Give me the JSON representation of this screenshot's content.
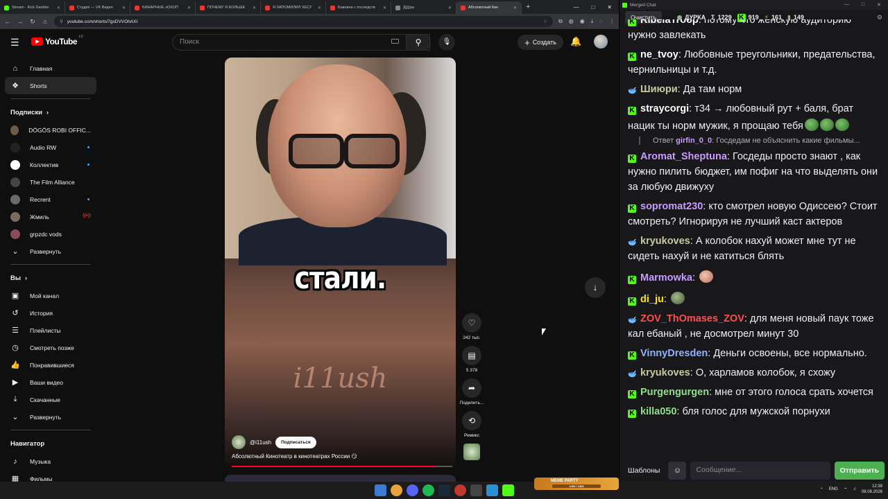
{
  "browser": {
    "tabs": [
      {
        "label": "Stream - Kick Dashbo",
        "color": "#53fc18"
      },
      {
        "label": "Студия — VK Видео",
        "color": "#e53935"
      },
      {
        "label": "БИНАРНЫЕ лОХОП",
        "color": "#e53935"
      },
      {
        "label": "ПОЧЕМУ Я БОЛЬШЕ",
        "color": "#e53935"
      },
      {
        "label": "Я ЗАПОМИЛИЛ ХЕСУ",
        "color": "#e53935"
      },
      {
        "label": "Бавовна с последств",
        "color": "#e53935"
      },
      {
        "label": "Дј)ј)ра",
        "color": "#888888"
      },
      {
        "label": "Абсолютный Кин",
        "color": "#e53935",
        "active": true
      }
    ],
    "url": "youtube.com/shorts/7gsDVVOhAXI"
  },
  "youtube": {
    "logo_text": "YouTube",
    "country_code": "LV",
    "search_placeholder": "Поиск",
    "create_label": "Создать",
    "nav": [
      {
        "icon": "home-icon",
        "glyph": "⌂",
        "label": "Главная"
      },
      {
        "icon": "shorts-icon",
        "glyph": "❖",
        "label": "Shorts",
        "active": true
      }
    ],
    "subscriptions_heading": "Подписки",
    "subscriptions": [
      {
        "label": "DÖGÖS ROBI OFFIC...",
        "color": "#6d5a48"
      },
      {
        "label": "Audio RW",
        "color": "#222222",
        "dot": true
      },
      {
        "label": "Коллектив",
        "color": "#ffffff",
        "dot": true
      },
      {
        "label": "The Film Alliance",
        "color": "#444444"
      },
      {
        "label": "Recrent",
        "color": "#6a6a6a",
        "dot": true
      },
      {
        "label": "Жмиль",
        "color": "#7a6a60",
        "live": true
      },
      {
        "label": "grpzdc vods",
        "color": "#8a4a5a"
      }
    ],
    "expand_label_1": "Развернуть",
    "you_heading": "Вы",
    "you_items": [
      {
        "icon": "channel-icon",
        "glyph": "▣",
        "label": "Мой канал"
      },
      {
        "icon": "history-icon",
        "glyph": "↺",
        "label": "История"
      },
      {
        "icon": "playlists-icon",
        "glyph": "☰",
        "label": "Плейлисты"
      },
      {
        "icon": "watch-later-icon",
        "glyph": "◷",
        "label": "Смотреть позже"
      },
      {
        "icon": "liked-icon",
        "glyph": "👍",
        "label": "Понравившиеся"
      },
      {
        "icon": "your-videos-icon",
        "glyph": "▶",
        "label": "Ваши видео"
      },
      {
        "icon": "downloads-icon",
        "glyph": "⤓",
        "label": "Скачанные"
      }
    ],
    "expand_label_2": "Развернуть",
    "navigator_heading": "Навигатор",
    "navigator_items": [
      {
        "icon": "music-icon",
        "glyph": "♪",
        "label": "Музыка"
      },
      {
        "icon": "movies-icon",
        "glyph": "▦",
        "label": "Фильмы"
      }
    ],
    "short": {
      "caption": "стали.",
      "watermark": "i11ush",
      "channel": "@i11ush",
      "subscribe_label": "Подписаться",
      "title": "Абсолютный Кинотеатр в кинотеатрах России 😏",
      "progress": 0.92
    },
    "actions": {
      "likes": "242 тыс.",
      "comments": "5 378",
      "share": "Поделить...",
      "remix": "Ремикс"
    }
  },
  "chat": {
    "window_title": "Merged Chat",
    "clear_label": "Очистить",
    "channel_name": "ДУРКА",
    "stats": {
      "sigma": "1229",
      "kick": "919",
      "other": "161",
      "bag": "149"
    },
    "messages": [
      {
        "badge": "kick",
        "user": "RibelaTroop",
        "color": "#ffffff",
        "text": "потому что женскую аудиторию нужно завлекать"
      },
      {
        "badge": "kick",
        "user": "ne_tvoy",
        "color": "#ffffff",
        "text": "Любовные треугольники, предательства, чернильницы и т.д."
      },
      {
        "badge": "vk",
        "user": "Шиюри",
        "color": "#c9c9a0",
        "text": "Да там норм"
      },
      {
        "badge": "kick",
        "user": "straycorgi",
        "color": "#ffffff",
        "text": "т34 → любовный рут + баля, брат нацик ты норм мужик, я прощаю тебя",
        "emotes": 3
      },
      {
        "badge": "kick",
        "user": "Aromat_Sheptuna",
        "color": "#c79cff",
        "text": "Госдеды просто знают , как нужно пилить бюджет, им пофиг на что выделять они за любую движуху"
      },
      {
        "badge": "kick",
        "user": "sopromat230",
        "color": "#c79cff",
        "text": "кто смотрел новую Одиссею? Стоит смотреть? Игнорируя не лучший каст актеров"
      },
      {
        "badge": "vk",
        "user": "kryukoves",
        "color": "#c9c9a0",
        "text": "А колобок нахуй может мне тут не сидеть нахуй и не катиться блять"
      },
      {
        "badge": "kick",
        "user": "Marmowka",
        "color": "#c79cff",
        "text": ""
      },
      {
        "badge": "kick",
        "user": "di_ju",
        "color": "#ffe600",
        "text": ""
      },
      {
        "badge": "vk",
        "user": "ZOV_ThOmases_ZOV",
        "color": "#ff4f4f",
        "text": "для меня новый паук тоже кал ебаный , не досмотрел минут 30"
      },
      {
        "badge": "kick",
        "user": "VinnyDresden",
        "color": "#8fb2ff",
        "text": "Деньги освоены, все нормально."
      },
      {
        "badge": "vk",
        "user": "kryukoves",
        "color": "#c9c9a0",
        "text": "О, харламов колобок, я схожу"
      },
      {
        "badge": "kick",
        "user": "Purgengurgen",
        "color": "#8fe08a",
        "text": "мне от этого голоса срать хочется"
      },
      {
        "badge": "kick",
        "user": "killa050",
        "color": "#8fe08a",
        "text": "бля голос для мужской порнухи"
      }
    ],
    "reply": {
      "prefix": "Ответ",
      "user": "girfin_0_0",
      "text": "Госдедам не объяснить какие фильмы..."
    },
    "templates_label": "Шаблоны",
    "input_placeholder": "Сообщение...",
    "send_label": "Отправить"
  },
  "taskbar": {
    "meme_label": "MEME PARTY",
    "meme_progress": "1400 / 1300",
    "lang": "ENG",
    "time": "12:39",
    "date": "08.08.2026"
  }
}
